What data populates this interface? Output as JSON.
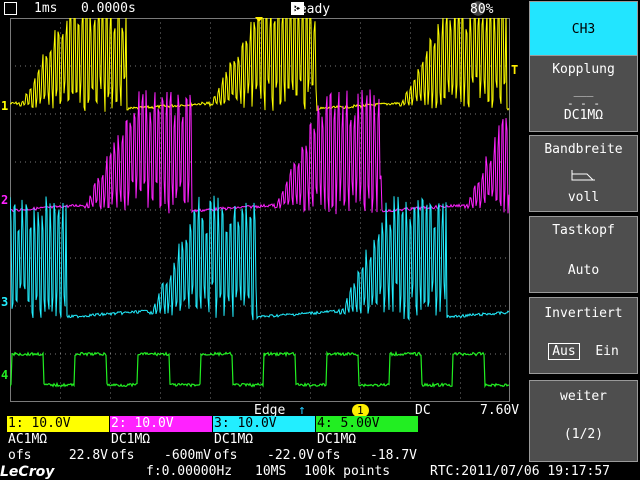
{
  "status": {
    "timebase": "1ms",
    "delay": "0.0000s",
    "state": "Ready",
    "battery": "80%"
  },
  "trigger": {
    "type": "Edge",
    "source": "1",
    "coupling": "DC",
    "level": "7.60V"
  },
  "channels": [
    {
      "id": "1",
      "color": "#ffff00",
      "header": "1: 10.0V",
      "coupling": "AC1MΩ",
      "ofs_label": "ofs",
      "ofs_value": "22.8V",
      "marker": "1"
    },
    {
      "id": "2",
      "color": "#ff22ff",
      "header": "2: 10.0V",
      "coupling": "DC1MΩ",
      "ofs_label": "ofs",
      "ofs_value": "-600mV",
      "marker": "2"
    },
    {
      "id": "3",
      "color": "#22eeff",
      "header": "3: 10.0V",
      "coupling": "DC1MΩ",
      "ofs_label": "ofs",
      "ofs_value": "-22.0V",
      "marker": "3"
    },
    {
      "id": "4",
      "color": "#22ee22",
      "header": "4: 5.00V",
      "coupling": "DC1MΩ",
      "ofs_label": "ofs",
      "ofs_value": "-18.7V",
      "marker": "4"
    }
  ],
  "bottom": {
    "logo": "LeCroy",
    "frequency": "f:0.00000Hz",
    "sample_rate": "10MS",
    "points": "100k points",
    "rtc": "RTC:2011/07/06 19:17:57"
  },
  "menu": {
    "active": "CH3",
    "kopplung_title": "Kopplung",
    "kopplung_value": "DC1MΩ",
    "bandbreite_title": "Bandbreite",
    "bandbreite_value": "voll",
    "tastkopf_title": "Tastkopf",
    "tastkopf_value": "Auto",
    "invertiert_title": "Invertiert",
    "invertiert_off": "Aus",
    "invertiert_on": "Ein",
    "weiter_title": "weiter",
    "weiter_page": "(1/2)"
  },
  "colors": {
    "grid": "#7a7a7a",
    "menu_active": "#22e5ff",
    "menu_button": "#4e4e4e"
  }
}
